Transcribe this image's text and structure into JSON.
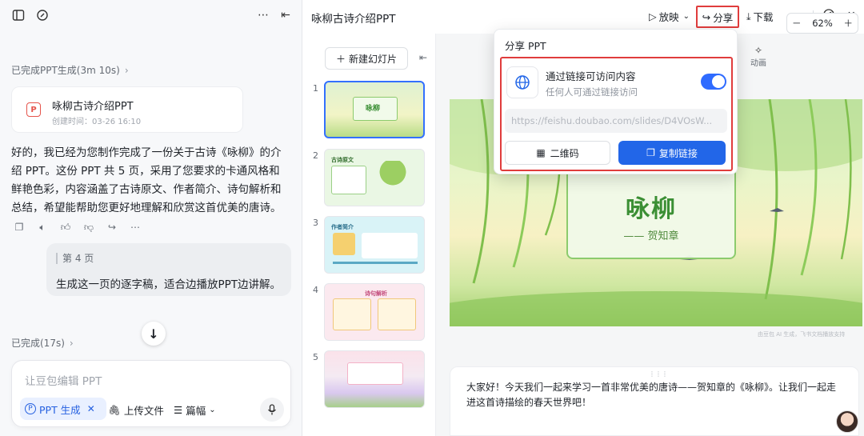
{
  "left_panel": {
    "status_generated": "已完成PPT生成(3m 10s)",
    "file_card": {
      "title": "咏柳古诗介绍PPT",
      "created": "创建时间：03-26 16:10",
      "badge": "P"
    },
    "reply": "好的，我已经为您制作完成了一份关于古诗《咏柳》的介绍 PPT。这份 PPT 共 5 页，采用了您要求的卡通风格和鲜艳色彩，内容涵盖了古诗原文、作者简介、诗句解析和总结，希望能帮助您更好地理解和欣赏这首优美的唐诗。",
    "user_quote": "第 4 页",
    "user_message": "生成这一页的逐字稿，适合边播放PPT边讲解。",
    "status_done": "已完成(17s)",
    "composer": {
      "placeholder": "让豆包编辑 PPT",
      "chip_label": "PPT 生成",
      "upload_label": "上传文件",
      "length_label": "篇幅"
    }
  },
  "editor": {
    "doc_title": "咏柳古诗介绍PPT",
    "toolbar": {
      "present": "放映",
      "share": "分享",
      "download": "下载"
    },
    "new_slide": "新建幻灯片",
    "slide_numbers": [
      "1",
      "2",
      "3",
      "4",
      "5"
    ],
    "thumb_titles": [
      "咏柳",
      "古诗原文",
      "作者简介",
      "诗句解析",
      ""
    ],
    "animation_label": "动画",
    "zoom": "62%",
    "slide": {
      "title": "咏柳",
      "author": "—— 贺知章"
    },
    "watermark": "由豆包 AI 生成，飞书文档播放支持",
    "notes": "大家好！今天我们一起来学习一首非常优美的唐诗——贺知章的《咏柳》。让我们一起走进这首诗描绘的春天世界吧！"
  },
  "share_popover": {
    "title": "分享 PPT",
    "link_heading": "通过链接可访问内容",
    "link_desc": "任何人可通过链接访问",
    "toggle_on": true,
    "url": "https://feishu.doubao.com/slides/D4VOsW...",
    "qr_label": "二维码",
    "copy_label": "复制链接"
  },
  "colors": {
    "accent": "#2266e8",
    "highlight": "#e03c3c",
    "slide_green": "#3b8f34"
  }
}
